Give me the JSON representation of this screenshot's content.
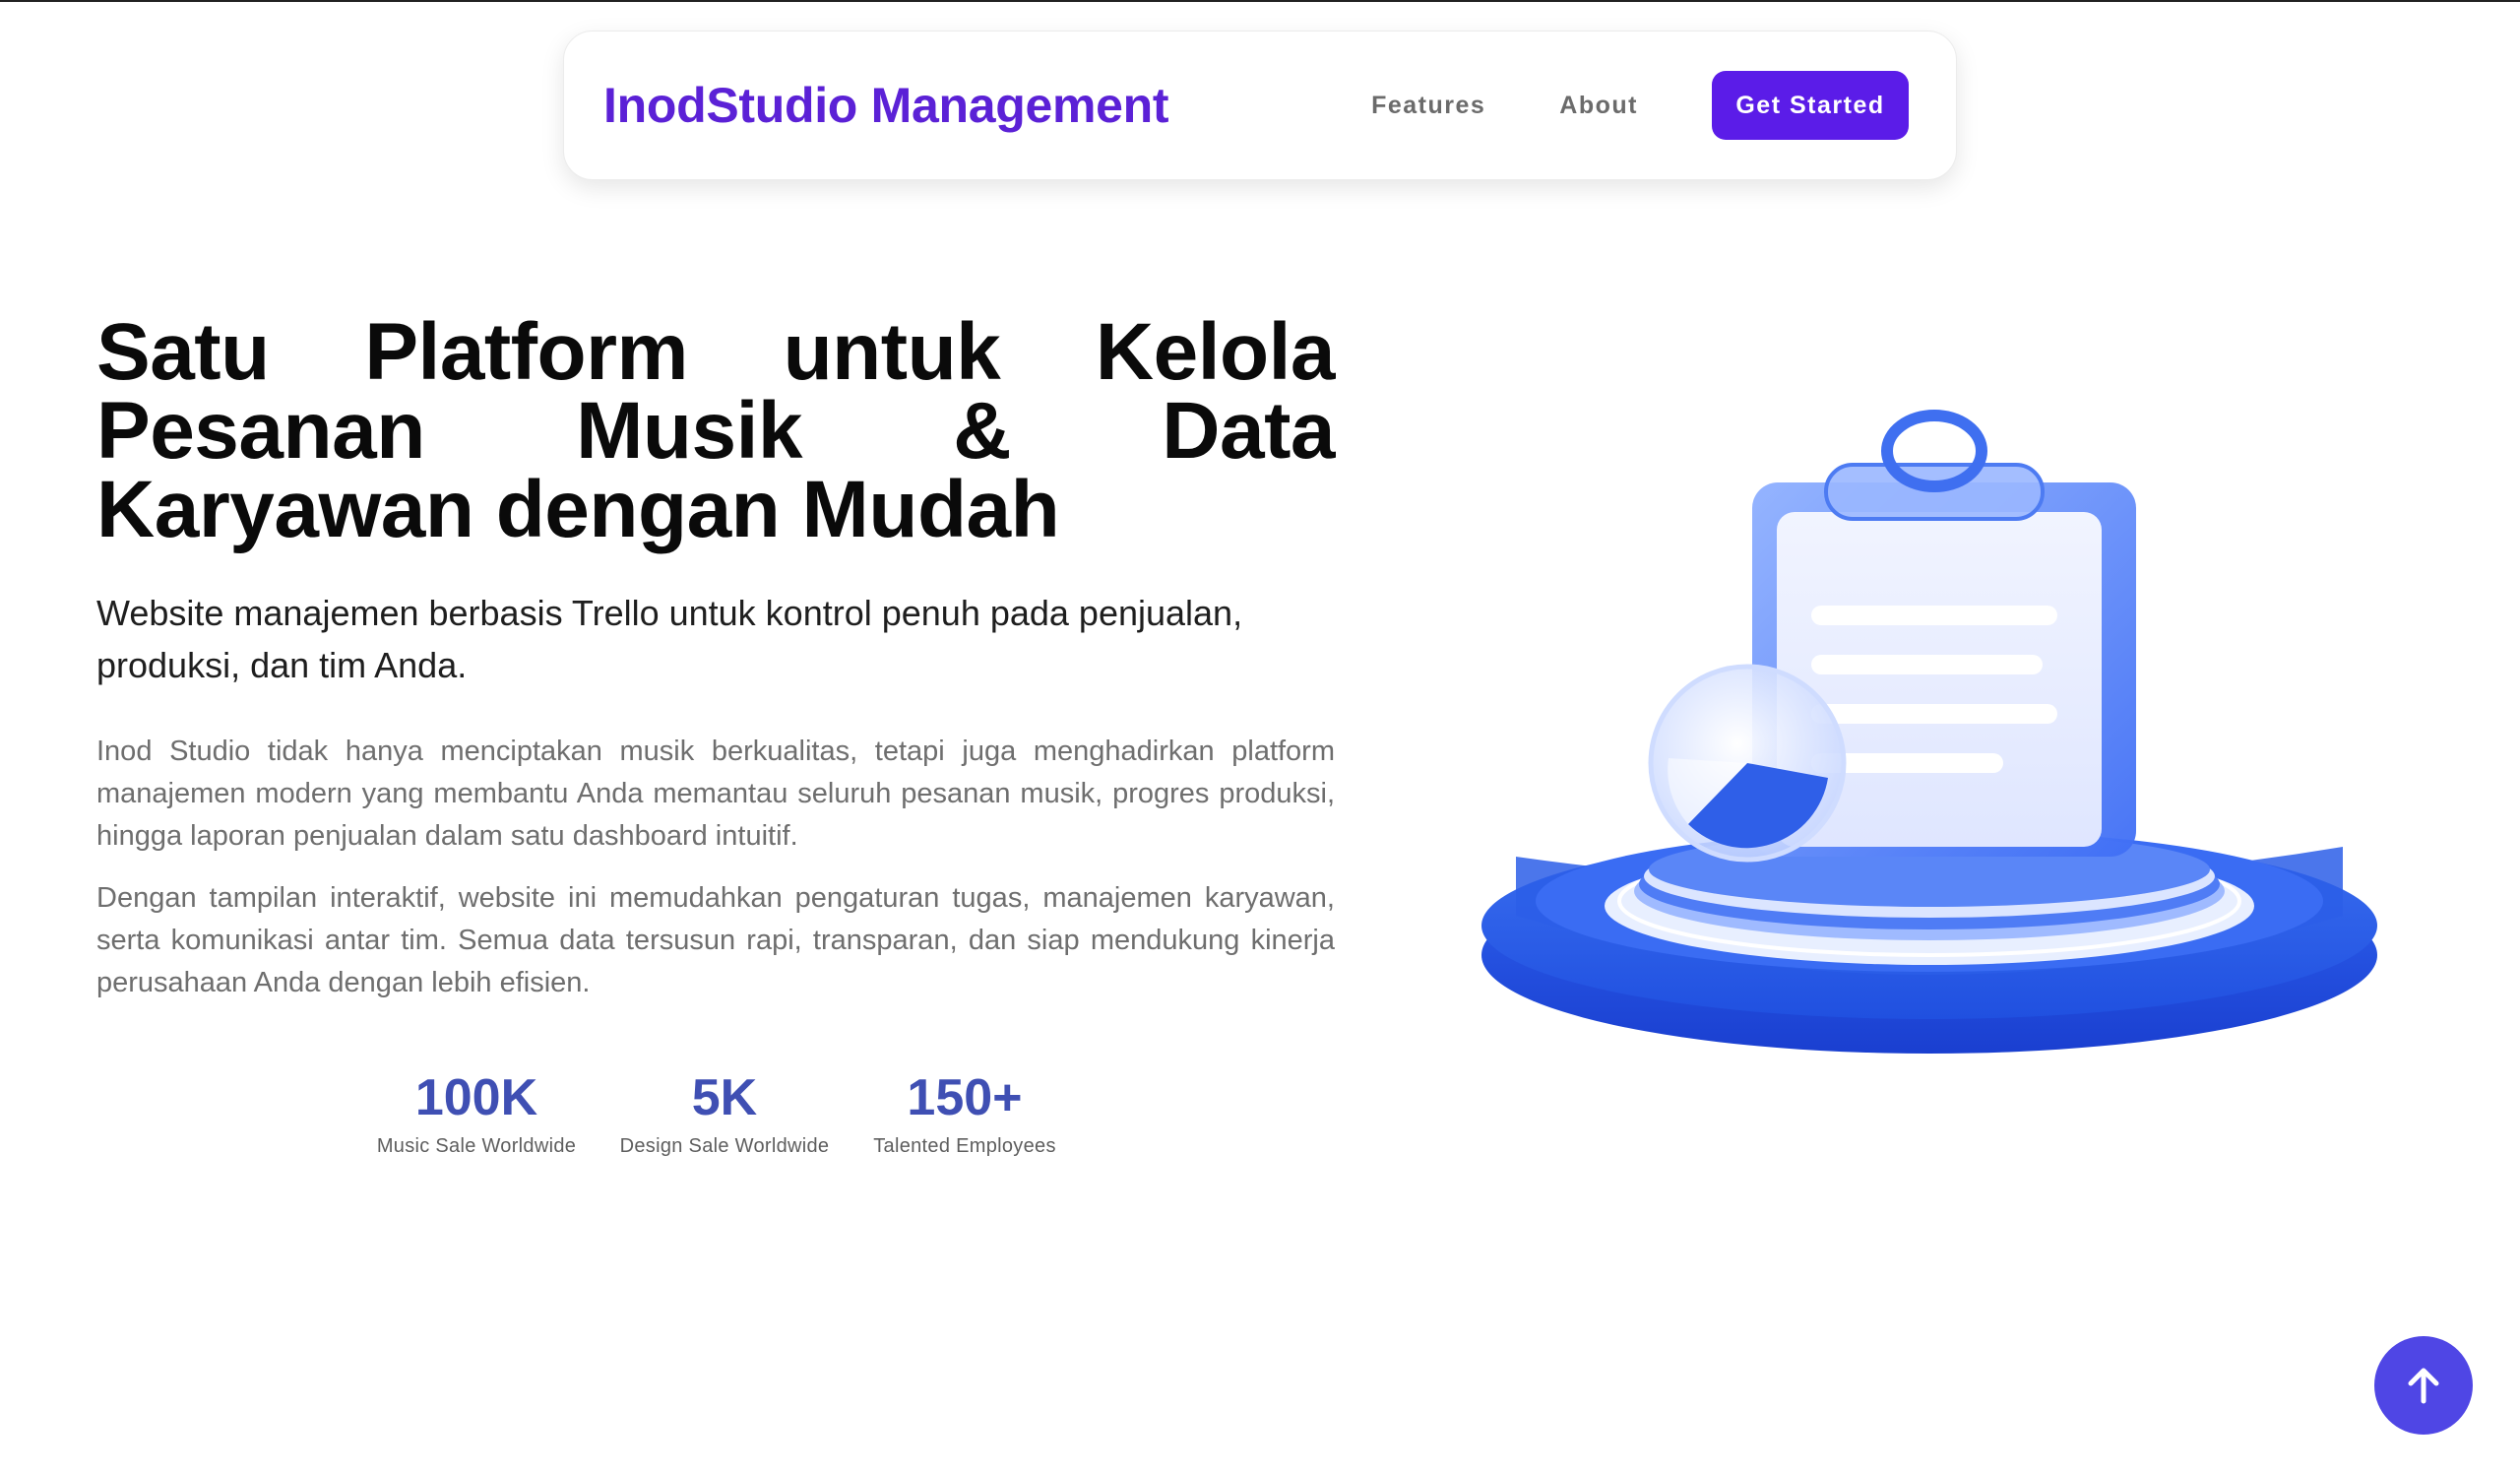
{
  "nav": {
    "brand": "InodStudio Management",
    "links": [
      "Features",
      "About"
    ],
    "cta": "Get Started"
  },
  "hero": {
    "title": "Satu Platform untuk Kelola Pesanan Musik & Data Karyawan dengan Mudah",
    "subtitle": "Website manajemen berbasis Trello untuk kontrol penuh pada penjualan, produksi, dan tim Anda.",
    "paragraphs": [
      "Inod Studio tidak hanya menciptakan musik berkualitas, tetapi juga menghadirkan platform manajemen modern yang membantu Anda memantau seluruh pesanan musik, progres produksi, hingga laporan penjualan dalam satu dashboard intuitif.",
      "Dengan tampilan interaktif, website ini memudahkan pengaturan tugas, manajemen karyawan, serta komunikasi antar tim. Semua data tersusun rapi, transparan, dan siap mendukung kinerja perusahaan Anda dengan lebih efisien."
    ]
  },
  "stats": [
    {
      "value": "100K",
      "label": "Music Sale Worldwide"
    },
    {
      "value": "5K",
      "label": "Design Sale Worldwide"
    },
    {
      "value": "150+",
      "label": "Talented Employees"
    }
  ],
  "icons": {
    "illustration": "clipboard-podium-illustration",
    "scroll_top": "arrow-up-icon"
  },
  "colors": {
    "brand": "#5b21d6",
    "cta": "#5b1ce8",
    "stat": "#3f4fb3",
    "scroll_button": "#4f46e5"
  }
}
